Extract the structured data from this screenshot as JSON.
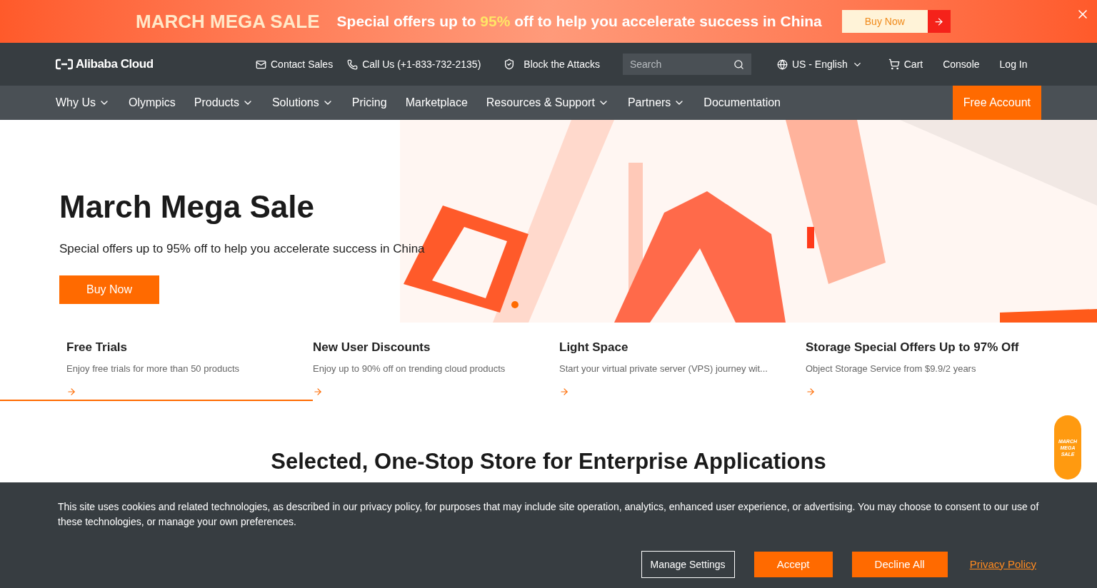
{
  "promo_banner": {
    "title": "MARCH MEGA SALE",
    "text_before": "Special offers up to ",
    "highlight": "95%",
    "text_after": " off to help you accelerate success in China",
    "button": "Buy Now"
  },
  "header": {
    "logo": "Alibaba Cloud",
    "links": [
      {
        "kind": "mail",
        "label": "Contact Sales"
      },
      {
        "kind": "phone",
        "label": "Call Us (+1-833-732-2135)"
      },
      {
        "kind": "shield",
        "label": "Block the Attacks"
      }
    ],
    "search": {
      "placeholder": "Search"
    },
    "language": "US - English",
    "cart": "Cart",
    "console": "Console",
    "login": "Log In"
  },
  "nav": {
    "items": [
      {
        "label": "Why Us",
        "dropdown": true
      },
      {
        "label": "Olympics",
        "dropdown": false
      },
      {
        "label": "Products",
        "dropdown": true
      },
      {
        "label": "Solutions",
        "dropdown": true
      },
      {
        "label": "Pricing",
        "dropdown": false
      },
      {
        "label": "Marketplace",
        "dropdown": false
      },
      {
        "label": "Resources & Support",
        "dropdown": true
      },
      {
        "label": "Partners",
        "dropdown": true
      },
      {
        "label": "Documentation",
        "dropdown": false
      }
    ],
    "cta": "Free Account"
  },
  "hero": {
    "title": "March Mega Sale",
    "subtitle": "Special offers up to 95% off to help you accelerate success in China",
    "button": "Buy Now"
  },
  "feature_tabs": [
    {
      "title": "Free Trials",
      "text": "Enjoy free trials for more than 50 products",
      "selected": true
    },
    {
      "title": "New User Discounts",
      "text": "Enjoy up to 90% off on trending cloud products",
      "selected": false
    },
    {
      "title": "Light Space",
      "text": "Start your virtual private server (VPS) journey wit...",
      "selected": false
    },
    {
      "title": "Storage Special Offers Up to 97% Off",
      "text": "Object Storage Service from $9.9/2 years",
      "selected": false
    }
  ],
  "section_title": "Selected, One-Stop Store for Enterprise Applications",
  "floating_badge": [
    "MARCH",
    "MEGA",
    "SALE"
  ],
  "cookie_bar": {
    "text": "This site uses cookies and related technologies, as described in our privacy policy, for purposes that may include site operation, analytics, enhanced user experience, or advertising. You may choose to consent to our use of these technologies, or manage your own preferences.",
    "buttons": [
      {
        "kind": "outline",
        "label": "Manage Settings"
      },
      {
        "kind": "filled",
        "label": "Accept"
      },
      {
        "kind": "filled",
        "label": "Decline All"
      },
      {
        "kind": "link",
        "label": "Privacy Policy"
      }
    ]
  }
}
